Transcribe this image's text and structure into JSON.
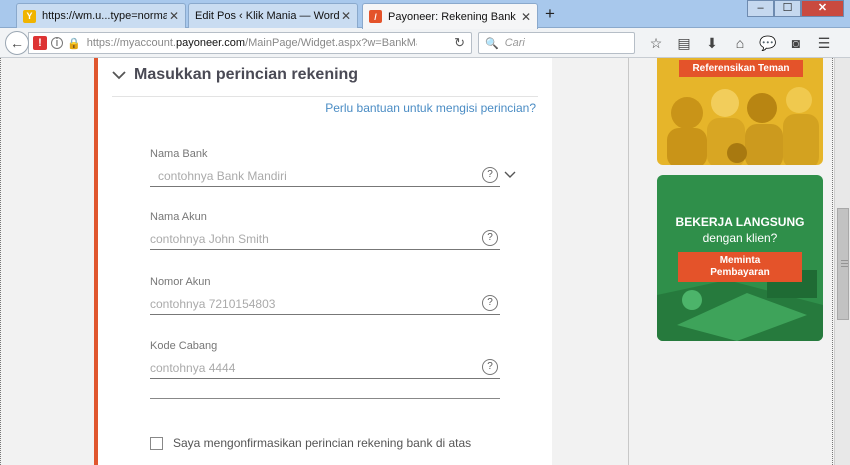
{
  "browser": {
    "tabs": [
      {
        "label": "https://wm.u...type=normal",
        "favicon_color": "#f0b400",
        "favicon_glyph": "Y",
        "active": false
      },
      {
        "label": "Edit Pos ‹ Klik Mania — WordPr...",
        "favicon_color": "",
        "favicon_glyph": "",
        "active": false
      },
      {
        "label": "Payoneer: Rekening Bank",
        "favicon_color": "#e4532a",
        "favicon_glyph": "/",
        "active": true
      }
    ],
    "tab_close_glyph": "✕",
    "new_tab_glyph": "+",
    "window_buttons": {
      "minimize": "–",
      "maximize": "☐",
      "close": "✕"
    },
    "url": {
      "prefix": "https://myaccount.",
      "host": "payoneer.com",
      "path": "/MainPage/Widget.aspx?w=BankManage"
    },
    "search_placeholder": "Cari",
    "toolbar_icons": [
      "star-icon",
      "reader-icon",
      "download-icon",
      "home-icon",
      "chat-icon",
      "pocket-icon",
      "menu-icon"
    ]
  },
  "form": {
    "section_title": "Masukkan perincian rekening",
    "help_link": "Perlu bantuan untuk mengisi perincian?",
    "fields": [
      {
        "label": "Nama Bank",
        "placeholder": "contohnya Bank Mandiri",
        "dropdown": true
      },
      {
        "label": "Nama Akun",
        "placeholder": "contohnya John Smith",
        "dropdown": false
      },
      {
        "label": "Nomor Akun",
        "placeholder": "contohnya 7210154803",
        "dropdown": false
      },
      {
        "label": "Kode Cabang",
        "placeholder": "contohnya 4444",
        "dropdown": false
      }
    ],
    "help_glyph": "?",
    "confirm_label": "Saya mengonfirmasikan perincian rekening bank di atas"
  },
  "ads": {
    "referral_button": "Referensikan Teman",
    "promo_title": "BEKERJA LANGSUNG",
    "promo_subtitle": "dengan klien?",
    "promo_button_line1": "Meminta",
    "promo_button_line2": "Pembayaran"
  },
  "colors": {
    "accent": "#e0562e",
    "link": "#4a8cc4",
    "ad_yellow": "#e6b52a",
    "ad_green": "#2f8f4a",
    "ad_button": "#e4532a"
  }
}
